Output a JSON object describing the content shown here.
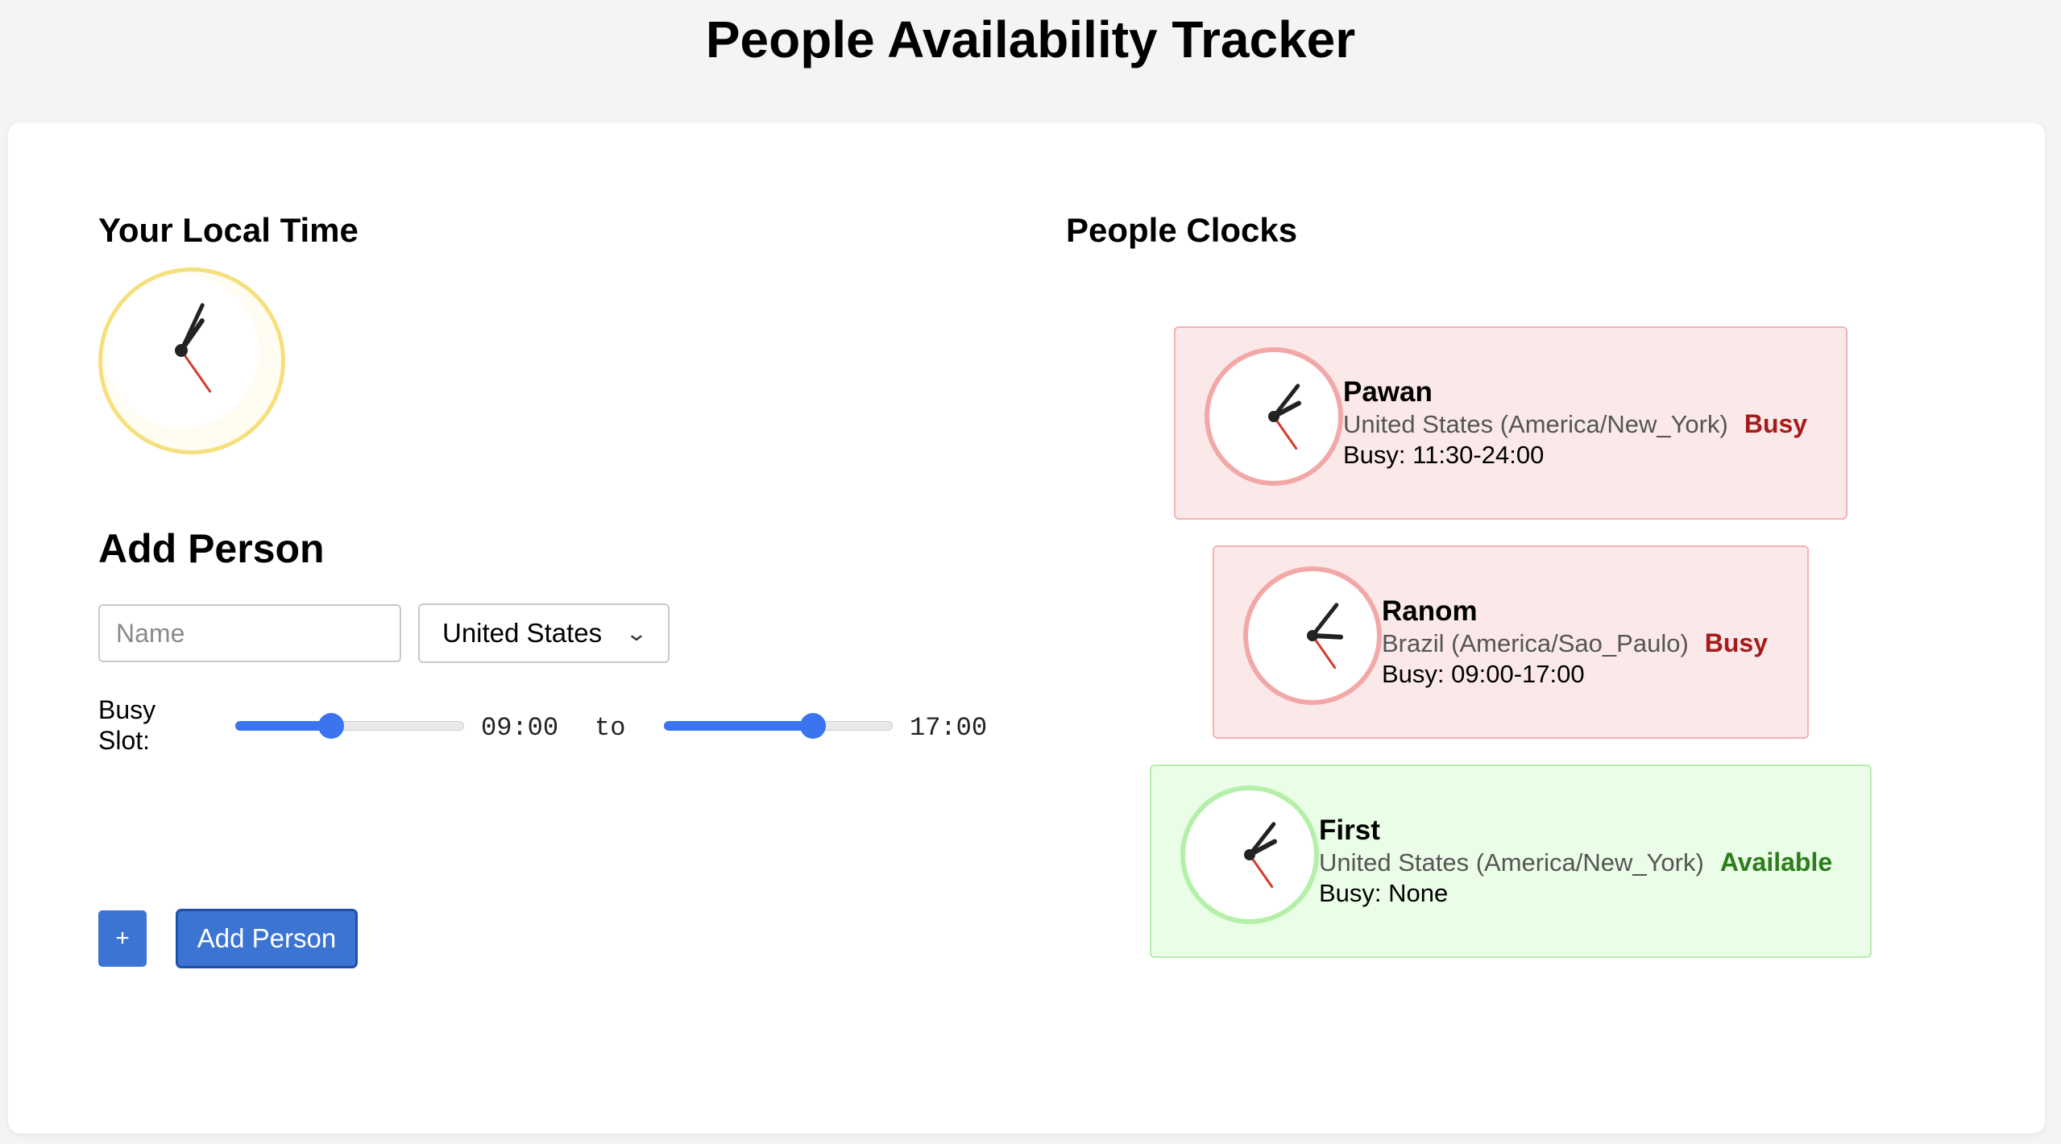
{
  "header": {
    "title": "People Availability Tracker"
  },
  "local": {
    "title": "Your Local Time",
    "clock": {
      "hour_angle": 35,
      "minute_angle": 25,
      "second_angle": 145
    }
  },
  "add_person": {
    "title": "Add Person",
    "name_placeholder": "Name",
    "country_selected": "United States",
    "busy_label": "Busy Slot:",
    "start_time": "09:00",
    "end_time": "17:00",
    "to_label": "to",
    "start_fraction": 0.42,
    "end_fraction": 0.65,
    "plus_label": "+",
    "add_button_label": "Add Person"
  },
  "people_section": {
    "title": "People Clocks"
  },
  "people": [
    {
      "name": "Pawan",
      "country": "United States (America/New_York)",
      "status": "Busy",
      "busy_slot": "Busy: 11:30-24:00",
      "state": "busy",
      "clock": {
        "hour_angle": 62,
        "minute_angle": 38,
        "second_angle": 145
      }
    },
    {
      "name": "Ranom",
      "country": "Brazil (America/Sao_Paulo)",
      "status": "Busy",
      "busy_slot": "Busy: 09:00-17:00",
      "state": "busy",
      "clock": {
        "hour_angle": 93,
        "minute_angle": 38,
        "second_angle": 145
      }
    },
    {
      "name": "First",
      "country": "United States (America/New_York)",
      "status": "Available",
      "busy_slot": "Busy: None",
      "state": "available",
      "clock": {
        "hour_angle": 62,
        "minute_angle": 38,
        "second_angle": 145
      }
    }
  ],
  "colors": {
    "accent": "#3b74d2",
    "busy_bg": "#fbe9e9",
    "busy_text": "#a51b1b",
    "available_bg": "#eafde6",
    "available_text": "#2d7d1e",
    "second_hand": "#d43b2f"
  }
}
